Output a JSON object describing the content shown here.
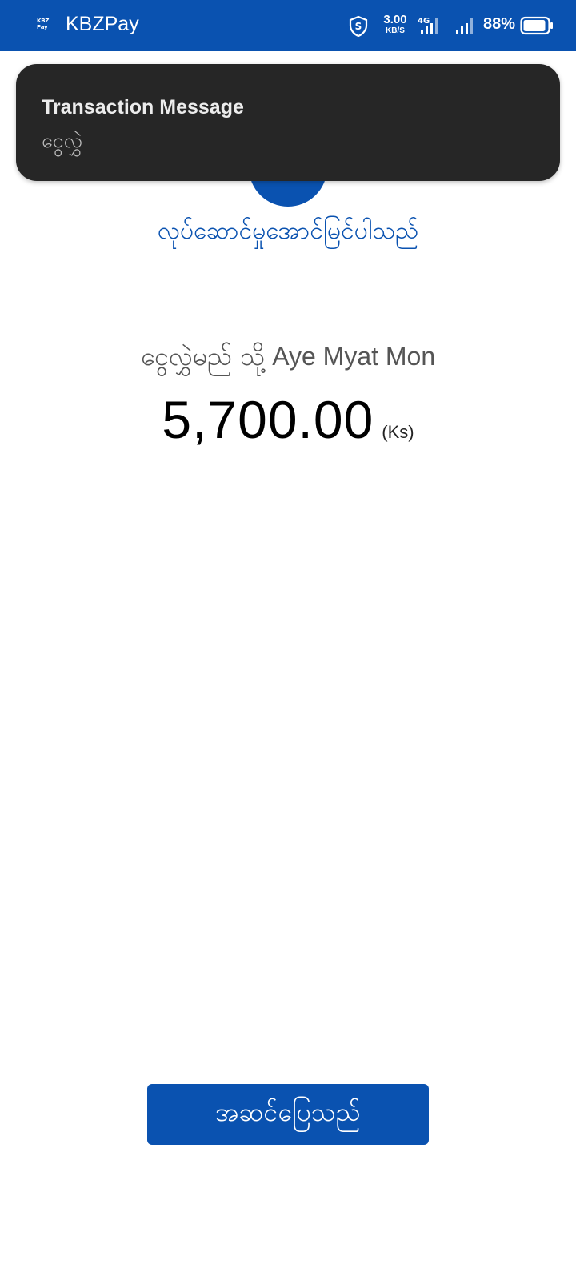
{
  "status_bar": {
    "app_logo_text": "KBZ Pay",
    "app_name": "KBZPay",
    "speed_value": "3.00",
    "speed_unit": "KB/S",
    "network_type": "4G",
    "battery_percent": "88%",
    "icons": [
      "shield-icon",
      "network-4g-icon",
      "signal-icon",
      "battery-icon"
    ],
    "background_color": "#0a52b0"
  },
  "notification": {
    "title": "Transaction Message",
    "body": "ငွေလွှဲ"
  },
  "main": {
    "success_message": "လုပ်ဆောင်မှုအောင်မြင်ပါသည်",
    "recipient_prefix": "ငွေလွှဲမည် သို့",
    "recipient_name": "Aye Myat Mon",
    "amount": "5,700.00",
    "currency": "(Ks)",
    "accent_color": "#0a52b0"
  },
  "actions": {
    "done_label": "အဆင်ပြေသည်"
  }
}
